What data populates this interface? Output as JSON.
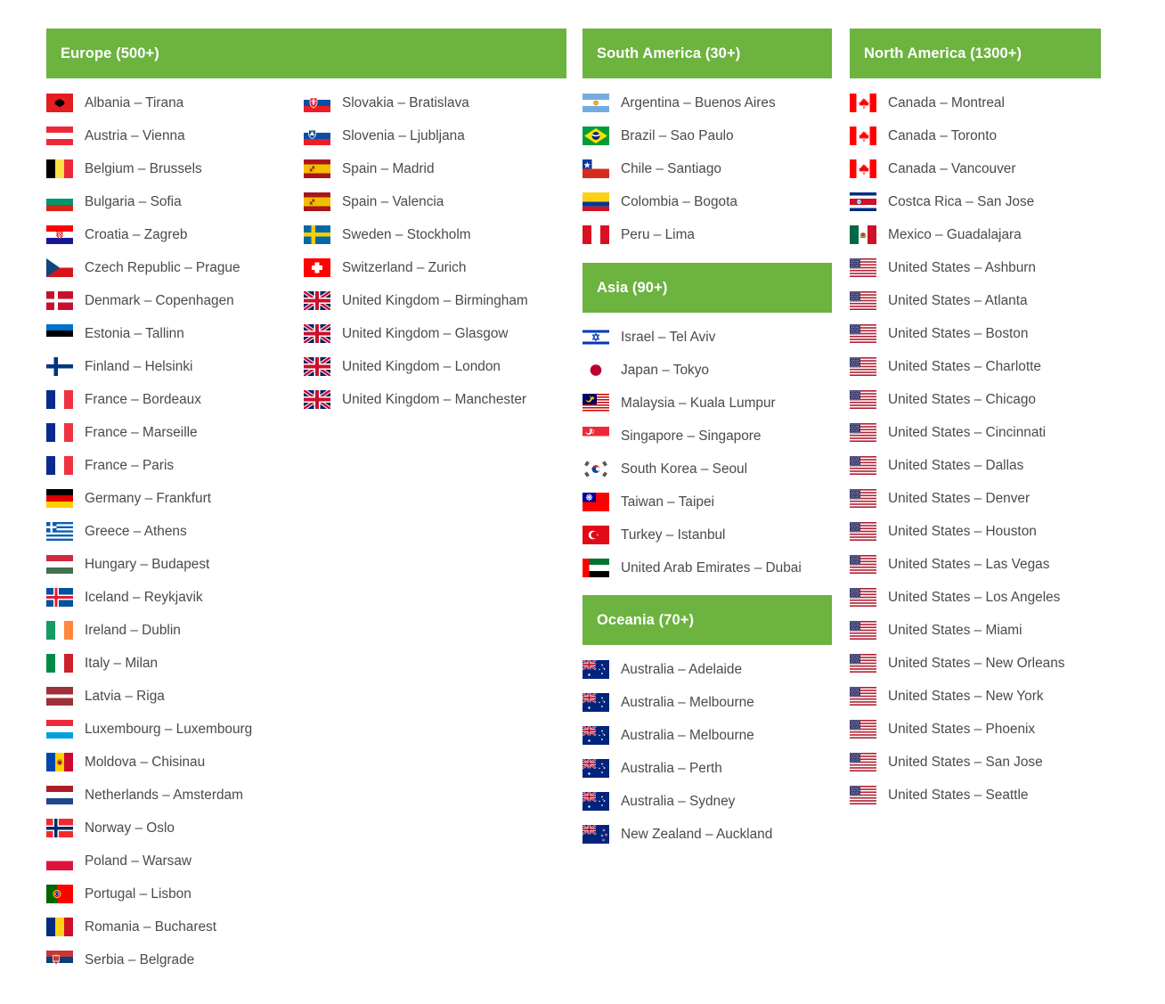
{
  "regions": [
    {
      "id": "europe",
      "title": "Europe (500+)",
      "columns": [
        [
          {
            "flag": "al",
            "label": "Albania – Tirana"
          },
          {
            "flag": "at",
            "label": "Austria – Vienna"
          },
          {
            "flag": "be",
            "label": "Belgium – Brussels"
          },
          {
            "flag": "bg",
            "label": "Bulgaria – Sofia"
          },
          {
            "flag": "hr",
            "label": "Croatia – Zagreb"
          },
          {
            "flag": "cz",
            "label": "Czech Republic – Prague"
          },
          {
            "flag": "dk",
            "label": "Denmark – Copenhagen"
          },
          {
            "flag": "ee",
            "label": "Estonia – Tallinn"
          },
          {
            "flag": "fi",
            "label": "Finland – Helsinki"
          },
          {
            "flag": "fr",
            "label": "France – Bordeaux"
          },
          {
            "flag": "fr",
            "label": "France – Marseille"
          },
          {
            "flag": "fr",
            "label": "France – Paris"
          },
          {
            "flag": "de",
            "label": "Germany – Frankfurt"
          },
          {
            "flag": "gr",
            "label": "Greece – Athens"
          },
          {
            "flag": "hu",
            "label": "Hungary – Budapest"
          },
          {
            "flag": "is",
            "label": "Iceland – Reykjavik"
          },
          {
            "flag": "ie",
            "label": "Ireland – Dublin"
          },
          {
            "flag": "it",
            "label": "Italy – Milan"
          },
          {
            "flag": "lv",
            "label": "Latvia – Riga"
          },
          {
            "flag": "lu",
            "label": "Luxembourg – Luxembourg"
          },
          {
            "flag": "md",
            "label": "Moldova – Chisinau"
          },
          {
            "flag": "nl",
            "label": "Netherlands – Amsterdam"
          },
          {
            "flag": "no",
            "label": "Norway – Oslo"
          },
          {
            "flag": "pl",
            "label": "Poland – Warsaw"
          },
          {
            "flag": "pt",
            "label": "Portugal – Lisbon"
          },
          {
            "flag": "ro",
            "label": "Romania – Bucharest"
          },
          {
            "flag": "rs",
            "label": "Serbia – Belgrade"
          }
        ],
        [
          {
            "flag": "sk",
            "label": "Slovakia – Bratislava"
          },
          {
            "flag": "si",
            "label": "Slovenia – Ljubljana"
          },
          {
            "flag": "es",
            "label": "Spain – Madrid"
          },
          {
            "flag": "es",
            "label": "Spain – Valencia"
          },
          {
            "flag": "se",
            "label": "Sweden – Stockholm"
          },
          {
            "flag": "ch",
            "label": "Switzerland – Zurich"
          },
          {
            "flag": "gb",
            "label": "United Kingdom – Birmingham"
          },
          {
            "flag": "gb",
            "label": "United Kingdom – Glasgow"
          },
          {
            "flag": "gb",
            "label": "United Kingdom – London"
          },
          {
            "flag": "gb",
            "label": "United Kingdom – Manchester"
          }
        ]
      ]
    },
    {
      "id": "south-america",
      "title": "South America (30+)",
      "items": [
        {
          "flag": "ar",
          "label": "Argentina – Buenos Aires"
        },
        {
          "flag": "br",
          "label": "Brazil – Sao Paulo"
        },
        {
          "flag": "cl",
          "label": "Chile – Santiago"
        },
        {
          "flag": "co",
          "label": "Colombia – Bogota"
        },
        {
          "flag": "pe",
          "label": "Peru – Lima"
        }
      ]
    },
    {
      "id": "asia",
      "title": "Asia (90+)",
      "items": [
        {
          "flag": "il",
          "label": "Israel – Tel Aviv"
        },
        {
          "flag": "jp",
          "label": "Japan – Tokyo"
        },
        {
          "flag": "my",
          "label": "Malaysia – Kuala Lumpur"
        },
        {
          "flag": "sg",
          "label": "Singapore – Singapore"
        },
        {
          "flag": "kr",
          "label": "South Korea – Seoul"
        },
        {
          "flag": "tw",
          "label": "Taiwan – Taipei"
        },
        {
          "flag": "tr",
          "label": "Turkey – Istanbul"
        },
        {
          "flag": "ae",
          "label": "United Arab Emirates – Dubai"
        }
      ]
    },
    {
      "id": "oceania",
      "title": "Oceania (70+)",
      "items": [
        {
          "flag": "au",
          "label": "Australia – Adelaide"
        },
        {
          "flag": "au",
          "label": "Australia – Melbourne"
        },
        {
          "flag": "au",
          "label": "Australia – Melbourne"
        },
        {
          "flag": "au",
          "label": "Australia – Perth"
        },
        {
          "flag": "au",
          "label": "Australia – Sydney"
        },
        {
          "flag": "nz",
          "label": "New Zealand – Auckland"
        }
      ]
    },
    {
      "id": "north-america",
      "title": "North America (1300+)",
      "items": [
        {
          "flag": "ca",
          "label": "Canada – Montreal"
        },
        {
          "flag": "ca",
          "label": "Canada – Toronto"
        },
        {
          "flag": "ca",
          "label": "Canada – Vancouver"
        },
        {
          "flag": "cr",
          "label": "Costca Rica – San Jose"
        },
        {
          "flag": "mx",
          "label": "Mexico – Guadalajara"
        },
        {
          "flag": "us",
          "label": "United States – Ashburn"
        },
        {
          "flag": "us",
          "label": "United States – Atlanta"
        },
        {
          "flag": "us",
          "label": "United States – Boston"
        },
        {
          "flag": "us",
          "label": "United States – Charlotte"
        },
        {
          "flag": "us",
          "label": "United States – Chicago"
        },
        {
          "flag": "us",
          "label": "United States – Cincinnati"
        },
        {
          "flag": "us",
          "label": "United States – Dallas"
        },
        {
          "flag": "us",
          "label": "United States – Denver"
        },
        {
          "flag": "us",
          "label": "United States – Houston"
        },
        {
          "flag": "us",
          "label": "United States – Las Vegas"
        },
        {
          "flag": "us",
          "label": "United States – Los Angeles"
        },
        {
          "flag": "us",
          "label": "United States – Miami"
        },
        {
          "flag": "us",
          "label": "United States – New Orleans"
        },
        {
          "flag": "us",
          "label": "United States – New York"
        },
        {
          "flag": "us",
          "label": "United States – Phoenix"
        },
        {
          "flag": "us",
          "label": "United States – San Jose"
        },
        {
          "flag": "us",
          "label": "United States – Seattle"
        }
      ]
    }
  ],
  "colors": {
    "header_green": "#6CB33F",
    "header_text": "#FFFFFF",
    "body_text": "#4A4A4A",
    "background": "#FFFFFF"
  }
}
